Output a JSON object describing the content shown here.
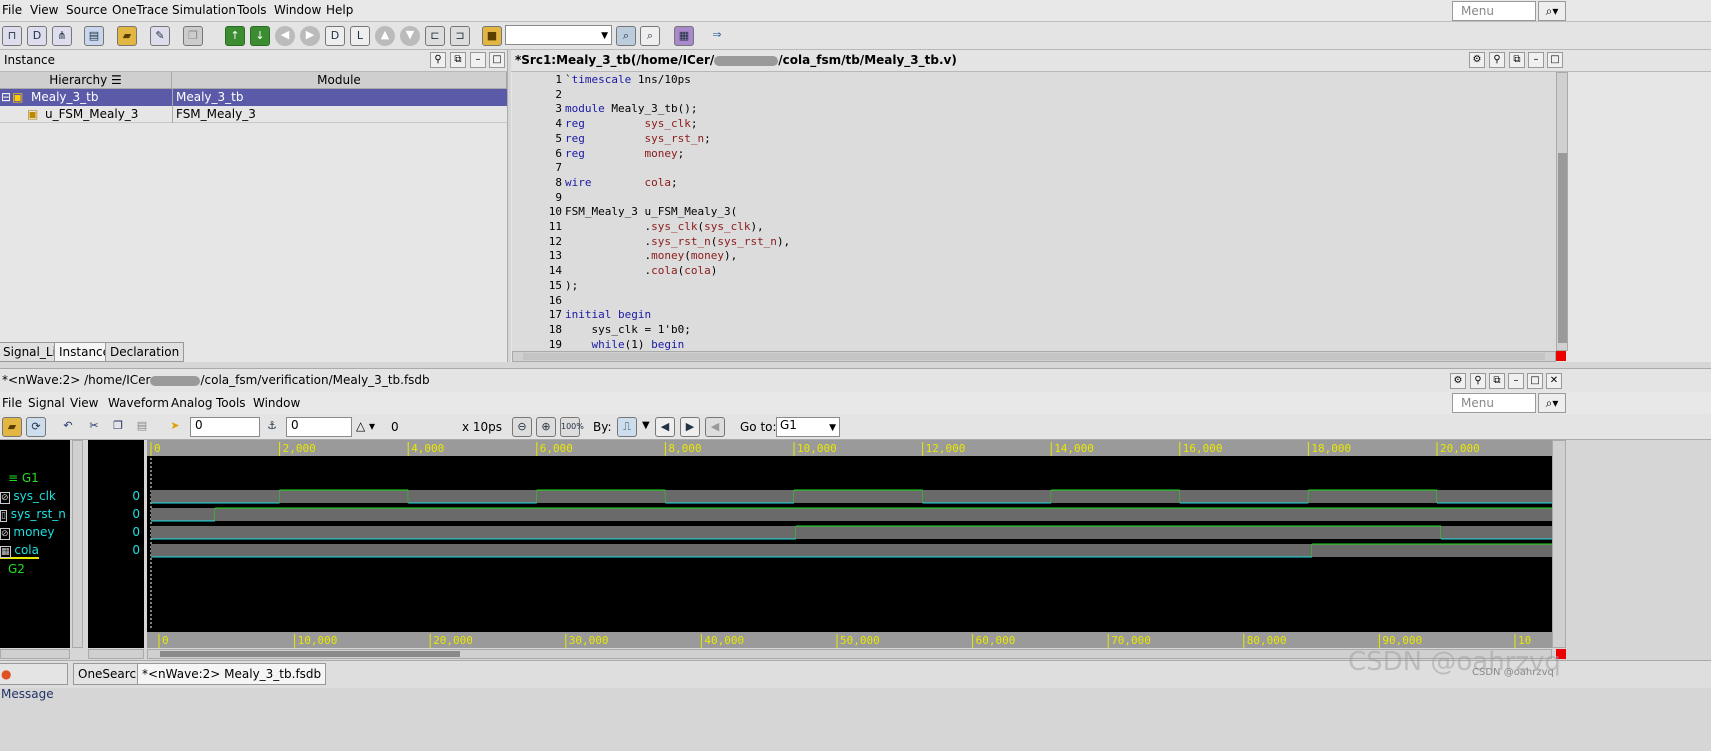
{
  "menu": {
    "items": [
      "File",
      "View",
      "Source",
      "OneTrace",
      "Simulation",
      "Tools",
      "Window",
      "Help"
    ],
    "search_placeholder": "Menu"
  },
  "toolbar": {
    "combo_value": ""
  },
  "instance_panel": {
    "title": "Instance",
    "columns": [
      "Hierarchy",
      "Module"
    ],
    "rows": [
      {
        "hierarchy": "Mealy_3_tb",
        "module": "Mealy_3_tb",
        "selected": true
      },
      {
        "hierarchy": "u_FSM_Mealy_3",
        "module": "FSM_Mealy_3",
        "selected": false
      }
    ],
    "tabs": [
      "Signal_List",
      "Instance",
      "Declaration"
    ]
  },
  "source_panel": {
    "title": "*Src1:Mealy_3_tb(/home/ICer/",
    "title_tail": "/cola_fsm/tb/Mealy_3_tb.v)",
    "lines": [
      {
        "n": "1",
        "t": "`timescale 1ns/10ps"
      },
      {
        "n": "2",
        "t": ""
      },
      {
        "n": "3",
        "t": "module Mealy_3_tb();"
      },
      {
        "n": "4",
        "t": "reg         sys_clk;"
      },
      {
        "n": "5",
        "t": "reg         sys_rst_n;"
      },
      {
        "n": "6",
        "t": "reg         money;"
      },
      {
        "n": "7",
        "t": ""
      },
      {
        "n": "8",
        "t": "wire        cola;"
      },
      {
        "n": "9",
        "t": ""
      },
      {
        "n": "10",
        "t": "FSM_Mealy_3 u_FSM_Mealy_3("
      },
      {
        "n": "11",
        "t": "            .sys_clk(sys_clk),"
      },
      {
        "n": "12",
        "t": "            .sys_rst_n(sys_rst_n),"
      },
      {
        "n": "13",
        "t": "            .money(money),"
      },
      {
        "n": "14",
        "t": "            .cola(cola)"
      },
      {
        "n": "15",
        "t": ");"
      },
      {
        "n": "16",
        "t": ""
      },
      {
        "n": "17",
        "t": "initial begin"
      },
      {
        "n": "18",
        "t": "    sys_clk = 1'b0;"
      },
      {
        "n": "19",
        "t": "    while(1) begin"
      }
    ]
  },
  "wave_window": {
    "title": "*<nWave:2> /home/ICer",
    "title_tail": "/cola_fsm/verification/Mealy_3_tb.fsdb",
    "menu": [
      "File",
      "Signal",
      "View",
      "Waveform",
      "Analog",
      "Tools",
      "Window"
    ],
    "search_placeholder": "Menu",
    "cursor_value": "0",
    "marker_value": "0",
    "delta_value": "0",
    "unit": "x 10ps",
    "by_label": "By:",
    "goto_label": "Go to:",
    "goto_value": "G1",
    "groups": [
      "G1",
      "G2"
    ],
    "signals": [
      {
        "name": "sys_clk",
        "value": "0"
      },
      {
        "name": "sys_rst_n",
        "value": "0"
      },
      {
        "name": "money",
        "value": "0"
      },
      {
        "name": "cola",
        "value": "0"
      }
    ],
    "top_ticks": [
      "0",
      "2,000",
      "4,000",
      "6,000",
      "8,000",
      "10,000",
      "12,000",
      "14,000",
      "16,000",
      "18,000",
      "20,000"
    ],
    "bottom_ticks": [
      "0",
      "10,000",
      "20,000",
      "30,000",
      "40,000",
      "50,000",
      "60,000",
      "70,000",
      "80,000",
      "90,000",
      "10"
    ]
  },
  "status_tabs": [
    "Message",
    "OneSearch",
    "*<nWave:2> Mealy_3_tb.fsdb"
  ],
  "watermark": "CSDN @oahrzvq",
  "watermark_small": "CSDN @oahrzvq"
}
